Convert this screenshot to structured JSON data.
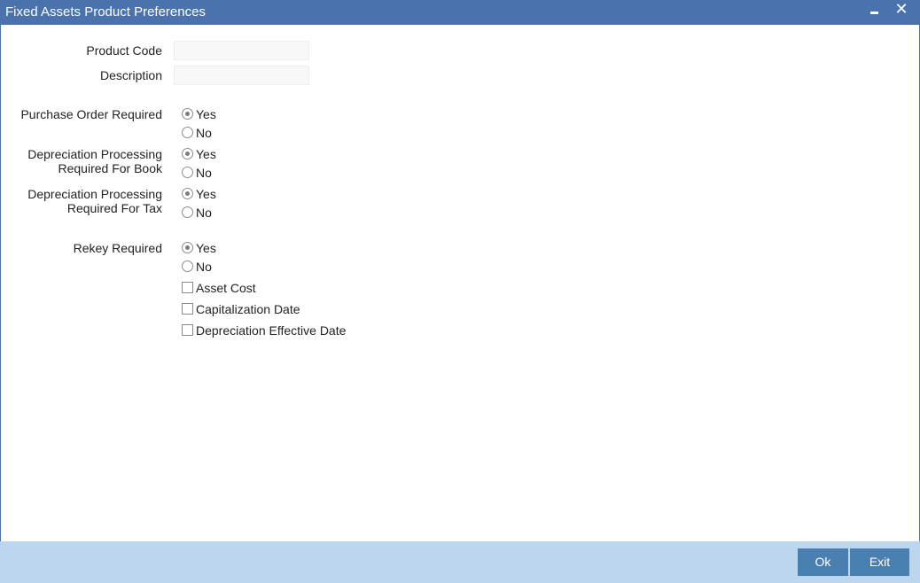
{
  "window": {
    "title": "Fixed Assets Product Preferences",
    "minimize_icon": "minimize-icon",
    "close_icon": "close-icon",
    "close_glyph": "✕"
  },
  "form": {
    "product_code": {
      "label": "Product Code",
      "value": ""
    },
    "description": {
      "label": "Description",
      "value": ""
    },
    "purchase_order": {
      "label": "Purchase Order Required",
      "yes": "Yes",
      "no": "No",
      "selected": "Yes"
    },
    "depr_book": {
      "label_line1": "Depreciation Processing",
      "label_line2": "Required For Book",
      "yes": "Yes",
      "no": "No",
      "selected": "Yes"
    },
    "depr_tax": {
      "label_line1": "Depreciation Processing",
      "label_line2": "Required For Tax",
      "yes": "Yes",
      "no": "No",
      "selected": "Yes"
    },
    "rekey": {
      "label": "Rekey Required",
      "yes": "Yes",
      "no": "No",
      "selected": "Yes"
    },
    "checkboxes": {
      "asset_cost": {
        "label": "Asset Cost",
        "checked": false
      },
      "capitalization_date": {
        "label": "Capitalization Date",
        "checked": false
      },
      "depr_effective_date": {
        "label": "Depreciation Effective Date",
        "checked": false
      }
    }
  },
  "footer": {
    "ok_label": "Ok",
    "exit_label": "Exit"
  },
  "colors": {
    "titlebar": "#4a72ad",
    "footer": "#bcd6ee",
    "button": "#4a7fb1"
  }
}
